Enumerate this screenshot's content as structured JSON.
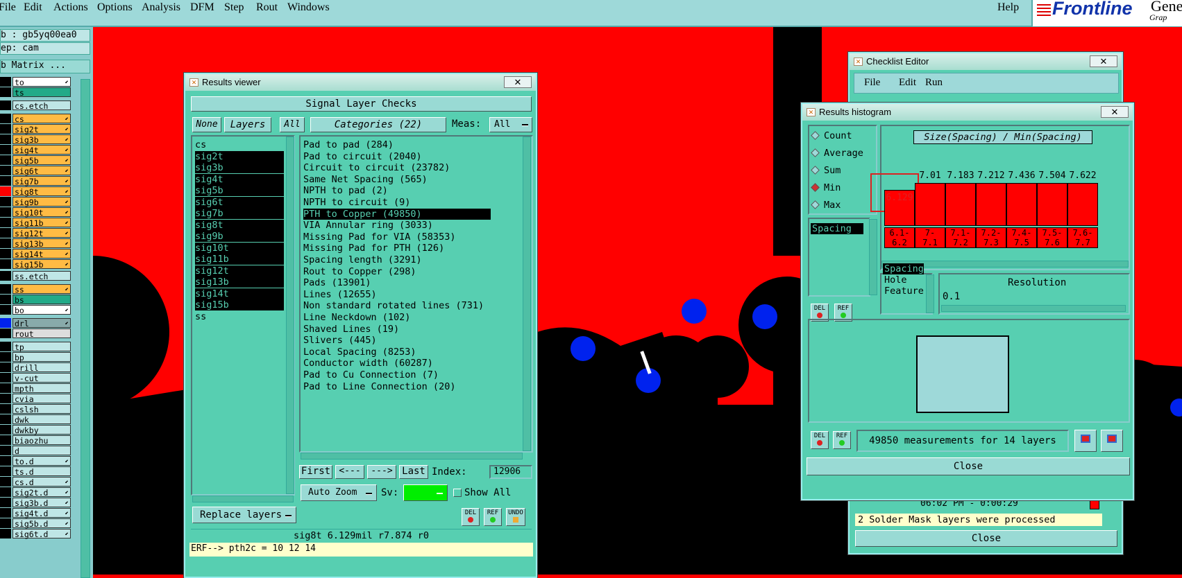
{
  "menu": {
    "items": [
      "File",
      "Edit",
      "Actions",
      "Options",
      "Analysis",
      "DFM",
      "Step",
      "Rout",
      "Windows"
    ],
    "help": "Help",
    "brand": "Frontline",
    "brand_suffix": "Gene",
    "brand_sub": "Grap"
  },
  "left_panel": {
    "job": "b : gb5yq00ea0",
    "step": "ep: cam",
    "matrix_button": "b Matrix ...",
    "layers": [
      {
        "name": "to",
        "color": "#ffffff",
        "arrow": true
      },
      {
        "name": "ts",
        "color": "#22aa88",
        "arrow": false
      },
      {
        "name": "cs.etch",
        "color": "#bfe6e6",
        "arrow": false
      },
      {
        "name": "cs",
        "color": "#ffbb44",
        "arrow": true
      },
      {
        "name": "sig2t",
        "color": "#ffbb44",
        "arrow": true
      },
      {
        "name": "sig3b",
        "color": "#ffbb44",
        "arrow": true
      },
      {
        "name": "sig4t",
        "color": "#ffbb44",
        "arrow": true
      },
      {
        "name": "sig5b",
        "color": "#ffbb44",
        "arrow": true
      },
      {
        "name": "sig6t",
        "color": "#ffbb44",
        "arrow": true
      },
      {
        "name": "sig7b",
        "color": "#ffbb44",
        "arrow": true
      },
      {
        "name": "sig8t",
        "color": "#ffbb44",
        "arrow": true
      },
      {
        "name": "sig9b",
        "color": "#ffbb44",
        "arrow": true
      },
      {
        "name": "sig10t",
        "color": "#ffbb44",
        "arrow": true
      },
      {
        "name": "sig11b",
        "color": "#ffbb44",
        "arrow": true
      },
      {
        "name": "sig12t",
        "color": "#ffbb44",
        "arrow": true
      },
      {
        "name": "sig13b",
        "color": "#ffbb44",
        "arrow": true
      },
      {
        "name": "sig14t",
        "color": "#ffbb44",
        "arrow": true
      },
      {
        "name": "sig15b",
        "color": "#ffbb44",
        "arrow": true
      },
      {
        "name": "ss.etch",
        "color": "#bfe6e6",
        "arrow": false
      },
      {
        "name": "ss",
        "color": "#ffbb44",
        "arrow": true
      },
      {
        "name": "bs",
        "color": "#22aa88",
        "arrow": false
      },
      {
        "name": "bo",
        "color": "#ffffff",
        "arrow": true
      },
      {
        "name": "drl",
        "color": "#88aaaa",
        "arrow": true
      },
      {
        "name": "rout",
        "color": "#dddddd",
        "arrow": false
      },
      {
        "name": "tp",
        "color": "#bfe6e6",
        "arrow": false
      },
      {
        "name": "bp",
        "color": "#bfe6e6",
        "arrow": false
      },
      {
        "name": "drill",
        "color": "#bfe6e6",
        "arrow": false
      },
      {
        "name": "v-cut",
        "color": "#bfe6e6",
        "arrow": false
      },
      {
        "name": "mpth",
        "color": "#bfe6e6",
        "arrow": false
      },
      {
        "name": "cvia",
        "color": "#bfe6e6",
        "arrow": false
      },
      {
        "name": "cslsh",
        "color": "#bfe6e6",
        "arrow": false
      },
      {
        "name": "dwk",
        "color": "#bfe6e6",
        "arrow": false
      },
      {
        "name": "dwkby",
        "color": "#bfe6e6",
        "arrow": false
      },
      {
        "name": "biaozhu",
        "color": "#bfe6e6",
        "arrow": false
      },
      {
        "name": "d",
        "color": "#bfe6e6",
        "arrow": false
      },
      {
        "name": "to.d",
        "color": "#bfe6e6",
        "arrow": true
      },
      {
        "name": "ts.d",
        "color": "#bfe6e6",
        "arrow": false
      },
      {
        "name": "cs.d",
        "color": "#bfe6e6",
        "arrow": true
      },
      {
        "name": "sig2t.d",
        "color": "#bfe6e6",
        "arrow": true
      },
      {
        "name": "sig3b.d",
        "color": "#bfe6e6",
        "arrow": true
      },
      {
        "name": "sig4t.d",
        "color": "#bfe6e6",
        "arrow": true
      },
      {
        "name": "sig5b.d",
        "color": "#bfe6e6",
        "arrow": true
      },
      {
        "name": "sig6t.d",
        "color": "#bfe6e6",
        "arrow": true
      }
    ]
  },
  "results_viewer": {
    "title": "Results viewer",
    "header": "Signal Layer Checks",
    "none_btn": "None",
    "layers_btn": "Layers",
    "all_btn": "All",
    "categories_btn": "Categories (22)",
    "meas_label": "Meas:",
    "meas_value": "All",
    "layers": [
      "cs",
      "sig2t",
      "sig3b",
      "sig4t",
      "sig5b",
      "sig6t",
      "sig7b",
      "sig8t",
      "sig9b",
      "sig10t",
      "sig11b",
      "sig12t",
      "sig13b",
      "sig14t",
      "sig15b",
      "ss"
    ],
    "categories": [
      "Pad to pad (284)",
      "Pad to circuit (2040)",
      "Circuit to circuit (23782)",
      "Same Net Spacing (565)",
      "NPTH to pad (2)",
      "NPTH to circuit (9)",
      "PTH to Copper (49850)",
      "VIA Annular ring (3033)",
      "Missing Pad for VIA (58353)",
      "Missing Pad for PTH (126)",
      "Spacing length (3291)",
      "Rout to Copper (298)",
      "Pads (13901)",
      "Lines (12655)",
      "Non standard rotated lines (731)",
      "Line Neckdown (102)",
      "Shaved Lines (19)",
      "Slivers (445)",
      "Local Spacing (8253)",
      "Conductor width (60287)",
      "Pad to Cu Connection (7)",
      "Pad to Line Connection (20)"
    ],
    "first_btn": "First",
    "prev_btn": "<---",
    "next_btn": "--->",
    "last_btn": "Last",
    "index_label": "Index:",
    "index_value": "12906",
    "auto_zoom": "Auto Zoom",
    "sv_label": "Sv:",
    "show_all": "Show All",
    "replace_layers": "Replace layers",
    "del": "DEL",
    "ref": "REF",
    "undo": "UNDO",
    "status": "sig8t 6.129mil   r7.874   r0",
    "erf": "ERF--> pth2c = 10 12 14"
  },
  "checklist_editor": {
    "title": "Checklist Editor",
    "menu": [
      "File",
      "Edit",
      "Run"
    ],
    "status_time": "06:02 PM - 0:00:29",
    "message": "2 Solder Mask layers were processed",
    "close": "Close"
  },
  "histogram": {
    "title": "Results histogram",
    "modes": [
      "Count",
      "Average",
      "Sum",
      "Min",
      "Max"
    ],
    "selected_mode": "Min",
    "measure_list": [
      "Spacing"
    ],
    "chart_title": "Size(Spacing) / Min(Spacing)",
    "bars": [
      {
        "value": "6.129",
        "bin": "6.1-\n6.2",
        "level": 0.74
      },
      {
        "value": "7.01",
        "bin": "7-\n7.1",
        "level": 0.88
      },
      {
        "value": "7.183",
        "bin": "7.1-\n7.2",
        "level": 0.88
      },
      {
        "value": "7.212",
        "bin": "7.2-\n7.3",
        "level": 0.88
      },
      {
        "value": "7.436",
        "bin": "7.4-\n7.5",
        "level": 0.88
      },
      {
        "value": "7.504",
        "bin": "7.5-\n7.6",
        "level": 0.88
      },
      {
        "value": "7.622",
        "bin": "7.6-\n7.7",
        "level": 0.88
      }
    ],
    "attrs": [
      "Spacing",
      "Hole",
      "Feature"
    ],
    "resolution_label": "Resolution",
    "resolution_value": "0.1",
    "del": "DEL",
    "ref": "REF",
    "summary": "49850 measurements for 14 layers",
    "close": "Close"
  },
  "colors": {
    "copper": "#ff0000",
    "pad": "#0022ee",
    "panel": "#57cfb1",
    "menubar": "#9ed9d9",
    "highlight": "#c33"
  }
}
